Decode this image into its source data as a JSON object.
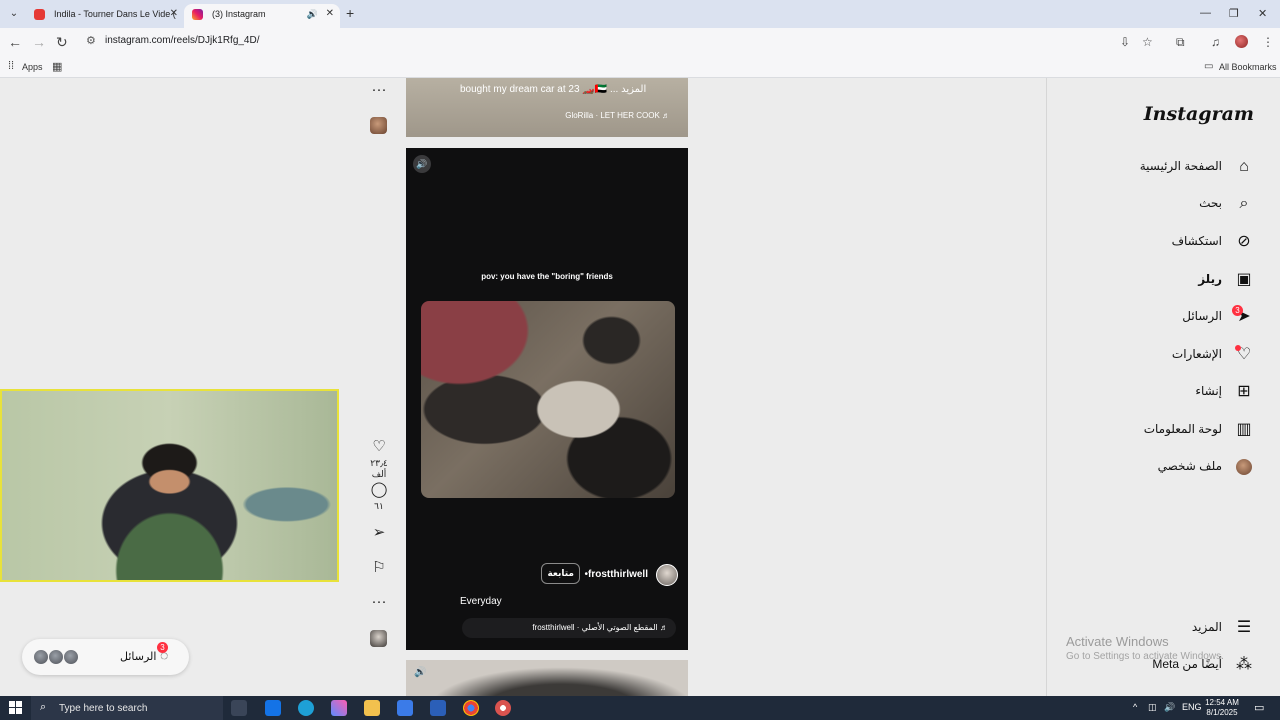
{
  "browser": {
    "tabs": [
      {
        "title": "Indila - Tourner Dans Le Vide (",
        "icon": "youtube-icon",
        "active": false
      },
      {
        "title": "(3) Instagram",
        "icon": "instagram-icon",
        "active": true
      }
    ],
    "url": "instagram.com/reels/DJjk1Rfg_4D/",
    "bookmarks": {
      "apps": "Apps",
      "all": "All Bookmarks"
    }
  },
  "instagram": {
    "logo": "Instagram",
    "nav": [
      {
        "label": "الصفحة الرئيسية",
        "icon": "home-icon"
      },
      {
        "label": "بحث",
        "icon": "search-icon"
      },
      {
        "label": "استكشاف",
        "icon": "explore-icon"
      },
      {
        "label": "ريلز",
        "icon": "reels-icon"
      },
      {
        "label": "الرسائل",
        "icon": "messages-icon",
        "badge": "3"
      },
      {
        "label": "الإشعارات",
        "icon": "heart-icon"
      },
      {
        "label": "إنشاء",
        "icon": "create-icon"
      },
      {
        "label": "لوحة المعلومات",
        "icon": "dashboard-icon"
      },
      {
        "label": "ملف شخصي",
        "icon": "profile-icon"
      }
    ],
    "more": "المزيد",
    "also_from_meta": "أيضًا من Meta",
    "reels": {
      "previous": {
        "caption": "bought my dream car at 23 🏎️🇦🇪 ... المزيد",
        "music": "GloRilla · LET HER COOK ♬"
      },
      "current": {
        "overlay_text": "pov: you have the \"boring\" friends",
        "username": "frostthirlwell",
        "follow": "متابعة",
        "caption": "Everyday",
        "audio": "♬ المقطع الصوتي الأصلي · frostthirlwell",
        "likes": "٢٣٫٤ ألف",
        "comments": "٦١"
      }
    },
    "messages_pill": {
      "label": "الرسائل",
      "badge": "3"
    }
  },
  "watermark": {
    "title": "Activate Windows",
    "subtitle": "Go to Settings to activate Windows."
  },
  "taskbar": {
    "search_placeholder": "Type here to search",
    "lang": "ENG",
    "time": "12:54 AM",
    "date": "8/1/2025"
  },
  "colors": {
    "accent_red": "#ff3040",
    "webcam_border": "#e8e23a"
  }
}
